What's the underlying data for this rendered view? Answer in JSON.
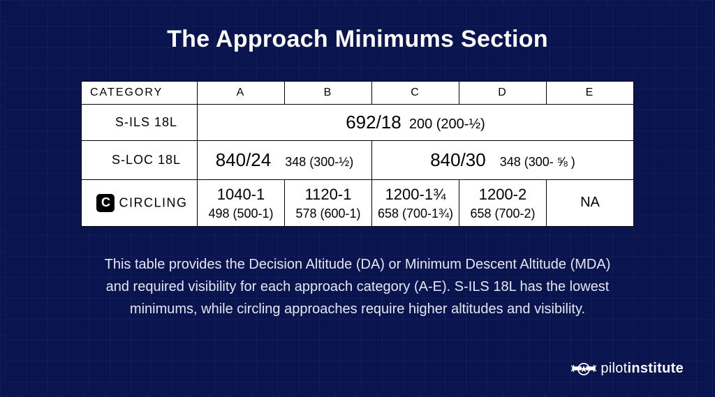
{
  "title": "The Approach Minimums Section",
  "headers": {
    "category": "CATEGORY",
    "cols": [
      "A",
      "B",
      "C",
      "D",
      "E"
    ]
  },
  "rows": {
    "ils": {
      "label": "S-ILS 18L",
      "value_big": "692/18",
      "value_small": "200 (200-½)"
    },
    "loc": {
      "label": "S-LOC 18L",
      "left_big": "840/24",
      "left_small": "348 (300-½)",
      "right_big": "840/30",
      "right_small": "348 (300- ⅝ )"
    },
    "circling": {
      "badge": "C",
      "label": "CIRCLING",
      "cells": [
        {
          "top": "1040-1",
          "bot": "498 (500-1)"
        },
        {
          "top": "1120-1",
          "bot": "578 (600-1)"
        },
        {
          "top": "1200-1¾",
          "bot": "658 (700-1¾)"
        },
        {
          "top": "1200-2",
          "bot": "658 (700-2)"
        }
      ],
      "na": "NA"
    }
  },
  "description": "This table provides the Decision Altitude (DA) or Minimum Descent Altitude (MDA) and required visibility for each approach category (A-E). S-ILS 18L has the lowest minimums, while circling approaches require higher altitudes and visibility.",
  "brand": {
    "name_light": "pilot",
    "name_bold": "institute"
  },
  "chart_data": {
    "type": "table",
    "title": "The Approach Minimums Section",
    "columns": [
      "CATEGORY",
      "A",
      "B",
      "C",
      "D",
      "E"
    ],
    "rows": [
      {
        "category": "S-ILS 18L",
        "A": "692/18 200 (200-1/2)",
        "B": "692/18 200 (200-1/2)",
        "C": "692/18 200 (200-1/2)",
        "D": "692/18 200 (200-1/2)",
        "E": "692/18 200 (200-1/2)"
      },
      {
        "category": "S-LOC 18L",
        "A": "840/24 348 (300-1/2)",
        "B": "840/24 348 (300-1/2)",
        "C": "840/30 348 (300-5/8)",
        "D": "840/30 348 (300-5/8)",
        "E": "840/30 348 (300-5/8)"
      },
      {
        "category": "CIRCLING",
        "A": "1040-1 498 (500-1)",
        "B": "1120-1 578 (600-1)",
        "C": "1200-1 3/4 658 (700-1 3/4)",
        "D": "1200-2 658 (700-2)",
        "E": "NA"
      }
    ]
  }
}
